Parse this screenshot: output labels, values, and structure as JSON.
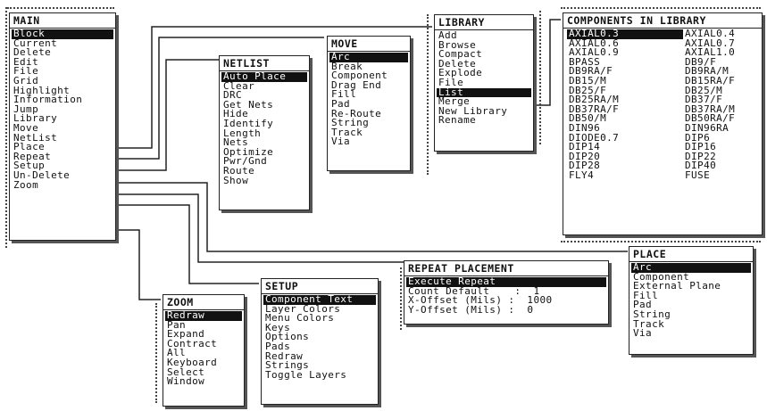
{
  "main": {
    "title": "MAIN",
    "items": [
      "Block",
      "Current",
      "Delete",
      "Edit",
      "File",
      "Grid",
      "Highlight",
      "Information",
      "Jump",
      "Library",
      "Move",
      "NetList",
      "Place",
      "Repeat",
      "Setup",
      "Un-Delete",
      "Zoom"
    ],
    "selected": "Block"
  },
  "netlist": {
    "title": "NETLIST",
    "items": [
      "Auto Place",
      "Clear",
      "DRC",
      "Get Nets",
      "Hide",
      "Identify",
      "Length",
      "Nets",
      "Optimize",
      "Pwr/Gnd",
      "Route",
      "Show"
    ],
    "selected": "Auto Place"
  },
  "move": {
    "title": "MOVE",
    "items": [
      "Arc",
      "Break",
      "Component",
      "Drag End",
      "Fill",
      "Pad",
      "Re-Route",
      "String",
      "Track",
      "Via"
    ],
    "selected": "Arc"
  },
  "library": {
    "title": "LIBRARY",
    "items": [
      "Add",
      "Browse",
      "Compact",
      "Delete",
      "Explode",
      "File",
      "List",
      "Merge",
      "New Library",
      "Rename"
    ],
    "selected": "List"
  },
  "components": {
    "title": "COMPONENTS IN LIBRARY",
    "items": [
      "AXIAL0.3",
      "AXIAL0.4",
      "AXIAL0.6",
      "AXIAL0.7",
      "AXIAL0.9",
      "AXIAL1.0",
      "BPASS",
      "DB9/F",
      "DB9RA/F",
      "DB9RA/M",
      "DB15/M",
      "DB15RA/F",
      "DB25/F",
      "DB25/M",
      "DB25RA/M",
      "DB37/F",
      "DB37RA/F",
      "DB37RA/M",
      "DB50/M",
      "DB50RA/F",
      "DIN96",
      "DIN96RA",
      "DIODE0.7",
      "DIP6",
      "DIP14",
      "DIP16",
      "DIP20",
      "DIP22",
      "DIP28",
      "DIP40",
      "FLY4",
      "FUSE"
    ],
    "selected": "AXIAL0.3"
  },
  "place": {
    "title": "PLACE",
    "items": [
      "Arc",
      "Component",
      "External Plane",
      "Fill",
      "Pad",
      "String",
      "Track",
      "Via"
    ],
    "selected": "Arc"
  },
  "repeat": {
    "title": "REPEAT PLACEMENT",
    "items": [
      "Execute Repeat",
      "Count Default    :  1",
      "X-Offset (Mils) :  1000",
      "Y-Offset (Mils) :  0"
    ],
    "selected": "Execute Repeat"
  },
  "setup": {
    "title": "SETUP",
    "items": [
      "Component Text",
      "Layer Colors",
      "Menu Colors",
      "Keys",
      "Options",
      "Pads",
      "Redraw",
      "Strings",
      "Toggle Layers"
    ],
    "selected": "Component Text"
  },
  "zoom": {
    "title": "ZOOM",
    "items": [
      "Redraw",
      "Pan",
      "Expand",
      "Contract",
      "All",
      "Keyboard",
      "Select",
      "Window"
    ],
    "selected": "Redraw"
  }
}
